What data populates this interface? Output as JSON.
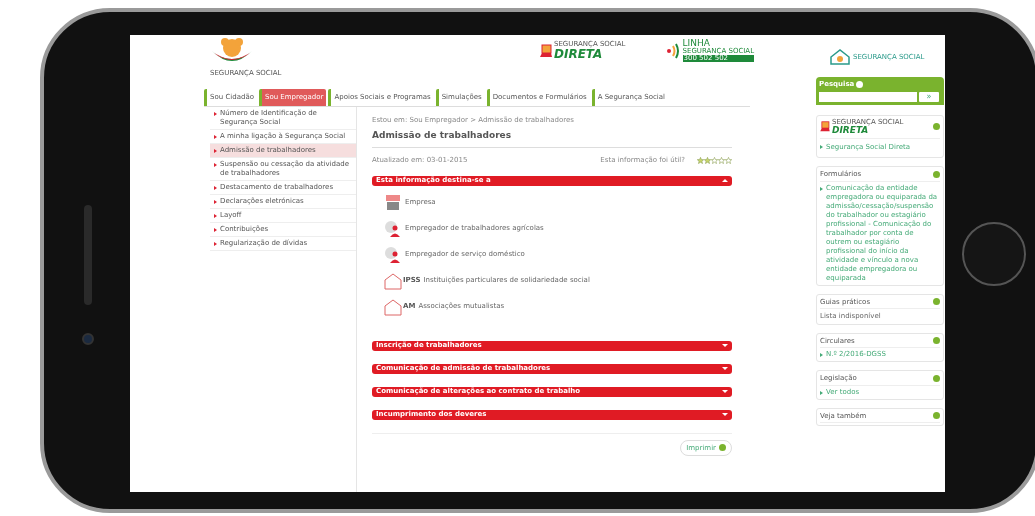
{
  "header": {
    "logo_text": "SEGURANÇA SOCIAL",
    "direta_logo": {
      "top": "SEGURANÇA SOCIAL",
      "main": "DIRETA"
    },
    "linha": {
      "title": "LINHA",
      "subtitle": "SEGURANÇA SOCIAL",
      "number": "300 502 502"
    },
    "ss_logo_text": "SEGURANÇA SOCIAL"
  },
  "tabs": [
    {
      "label": "Sou Cidadão",
      "selected": false
    },
    {
      "label": "Sou Empregador",
      "selected": true
    },
    {
      "label": "Apoios Sociais e Programas",
      "selected": false
    },
    {
      "label": "Simulações",
      "selected": false
    },
    {
      "label": "Documentos e Formulários",
      "selected": false
    },
    {
      "label": "A Segurança Social",
      "selected": false
    }
  ],
  "sidebar": {
    "items": [
      {
        "label": "Número de Identificação de Segurança Social",
        "selected": false
      },
      {
        "label": "A minha ligação à Segurança Social",
        "selected": false
      },
      {
        "label": "Admissão de trabalhadores",
        "selected": true
      },
      {
        "label": "Suspensão ou cessação da atividade de trabalhadores",
        "selected": false
      },
      {
        "label": "Destacamento de trabalhadores",
        "selected": false
      },
      {
        "label": "Declarações eletrónicas",
        "selected": false
      },
      {
        "label": "Layoff",
        "selected": false
      },
      {
        "label": "Contribuições",
        "selected": false
      },
      {
        "label": "Regularização de dívidas",
        "selected": false
      }
    ]
  },
  "breadcrumb": "Estou em:  Sou Empregador  >  Admissão de trabalhadores",
  "title": "Admissão de trabalhadores",
  "updated": "Atualizado em: 03-01-2015",
  "feedback": {
    "question": "Esta informação foi útil?",
    "stars": 2
  },
  "sections": [
    {
      "title": "Esta informação destina-se a",
      "expanded": true,
      "items": [
        {
          "kind": "building",
          "label": "Empresa"
        },
        {
          "kind": "person",
          "label": "Empregador de trabalhadores agrícolas"
        },
        {
          "kind": "person",
          "label": "Empregador de serviço doméstico"
        },
        {
          "kind": "house",
          "badge": "IPSS",
          "label": "Instituições particulares de solidariedade social"
        },
        {
          "kind": "house",
          "badge": "AM",
          "label": "Associações mutualistas"
        }
      ]
    },
    {
      "title": "Inscrição de trabalhadores",
      "expanded": false
    },
    {
      "title": "Comunicação de admissão de trabalhadores",
      "expanded": false
    },
    {
      "title": "Comunicação de alterações ao contrato de trabalho",
      "expanded": false
    },
    {
      "title": "Incumprimento dos deveres",
      "expanded": false
    }
  ],
  "print_button": "Imprimir",
  "search": {
    "title": "Pesquisa",
    "button": "»"
  },
  "direta_card": {
    "top": "SEGURANÇA SOCIAL",
    "main": "DIRETA",
    "link": "Segurança Social Direta"
  },
  "cards": [
    {
      "title": "Formulários",
      "kind": "links",
      "lines": [
        "Comunicação da entidade empregadora ou equiparada da admissão/cessação/suspensão do trabalhador ou estagiário profissional - Comunicação do trabalhador por conta de outrem ou estagiário profissional do início da atividade e vínculo a nova entidade empregadora ou equiparada"
      ]
    },
    {
      "title": "Guias práticos",
      "kind": "text",
      "lines": [
        "Lista indisponível"
      ]
    },
    {
      "title": "Circulares",
      "kind": "links",
      "lines": [
        "N.º 2/2016-DGSS"
      ]
    },
    {
      "title": "Legislação",
      "kind": "links",
      "lines": [
        "Ver todos"
      ]
    },
    {
      "title": "Veja também"
    }
  ]
}
